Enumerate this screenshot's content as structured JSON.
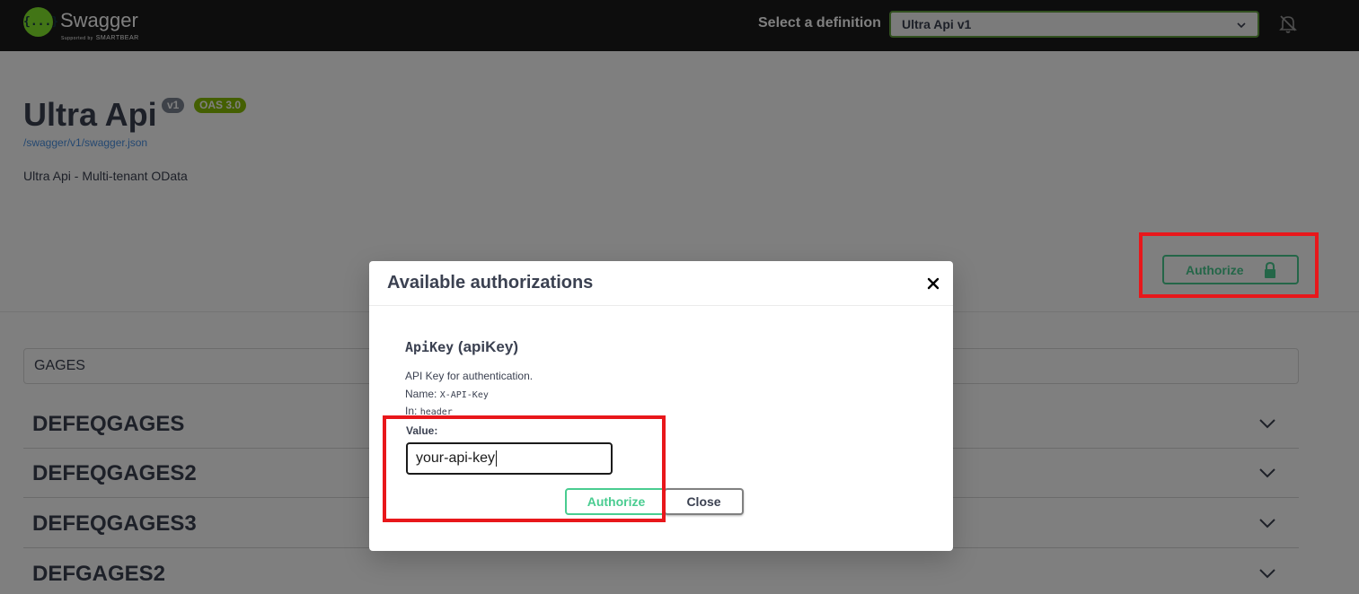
{
  "topbar": {
    "logo_text": "Swagger",
    "logo_glyph": "{...}",
    "logo_sub_prefix": "Supported by",
    "logo_sub_brand": "SMARTBEAR",
    "definition_label": "Select a definition",
    "definition_selected": "Ultra Api v1"
  },
  "info": {
    "title": "Ultra Api",
    "version_badge": "v1",
    "oas_badge": "OAS 3.0",
    "spec_link": "/swagger/v1/swagger.json",
    "description": "Ultra Api - Multi-tenant OData",
    "authorize_label": "Authorize"
  },
  "filter": {
    "value": "GAGES"
  },
  "operations": [
    {
      "name": "DEFEQGAGES"
    },
    {
      "name": "DEFEQGAGES2"
    },
    {
      "name": "DEFEQGAGES3"
    },
    {
      "name": "DEFGAGES2"
    }
  ],
  "modal": {
    "title": "Available authorizations",
    "close_glyph": "×",
    "scheme_code": "ApiKey",
    "scheme_type": "(apiKey)",
    "description": "API Key for authentication.",
    "name_label": "Name:",
    "name_value": "X-API-Key",
    "in_label": "In:",
    "in_value": "header",
    "value_label": "Value:",
    "value_input": "your-api-key",
    "authorize_button": "Authorize",
    "close_button": "Close"
  },
  "colors": {
    "topbar_bg": "#1b1b1b",
    "accent_green": "#49cc90",
    "highlight_red": "#e8171b",
    "overlay": "rgba(0,0,0,0.5)"
  }
}
